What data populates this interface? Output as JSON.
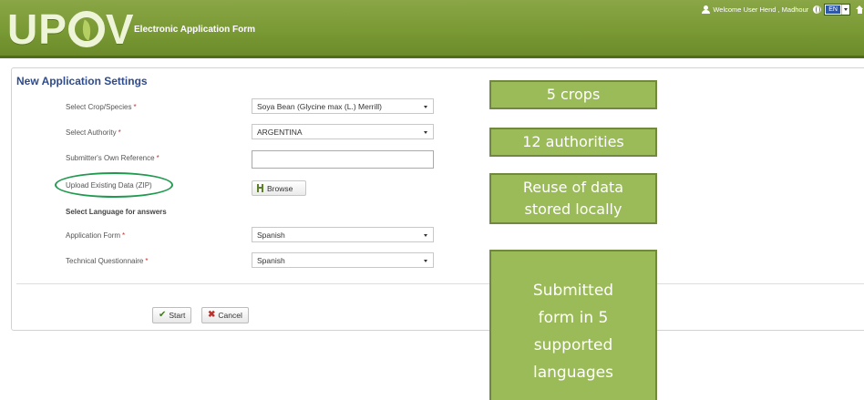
{
  "header": {
    "logo_text": "UPOV",
    "app_title": "Electronic Application Form",
    "welcome_text": "Welcome User Hend , Madhour",
    "language": "EN",
    "icons": [
      "user-icon",
      "globe-icon",
      "home-icon"
    ]
  },
  "form": {
    "title": "New Application Settings",
    "required_mark": "*",
    "crop_label": "Select Crop/Species",
    "crop_value": "Soya Bean (Glycine max (L.) Merrill)",
    "authority_label": "Select Authority",
    "authority_value": "ARGENTINA",
    "reference_label": "Submitter's Own Reference",
    "reference_value": "",
    "upload_label": "Upload Existing Data (ZIP)",
    "browse_label": "Browse",
    "language_section": "Select Language for answers",
    "app_form_label": "Application Form",
    "app_form_value": "Spanish",
    "tq_label": "Technical Questionnaire",
    "tq_value": "Spanish"
  },
  "actions": {
    "start_label": "Start",
    "cancel_label": "Cancel"
  },
  "callouts": {
    "crops": "5 crops",
    "authorities": "12 authorities",
    "reuse_line1": "Reuse of data",
    "reuse_line2": "stored locally",
    "submitted_line1": "Submitted",
    "submitted_line2": "form in 5",
    "submitted_line3": "supported",
    "submitted_line4": "languages"
  },
  "colors": {
    "header_green": "#7a9a35",
    "callout_green": "#9bbb59",
    "title_blue": "#2e4b8c",
    "highlight_ellipse": "#1f9a4f"
  }
}
